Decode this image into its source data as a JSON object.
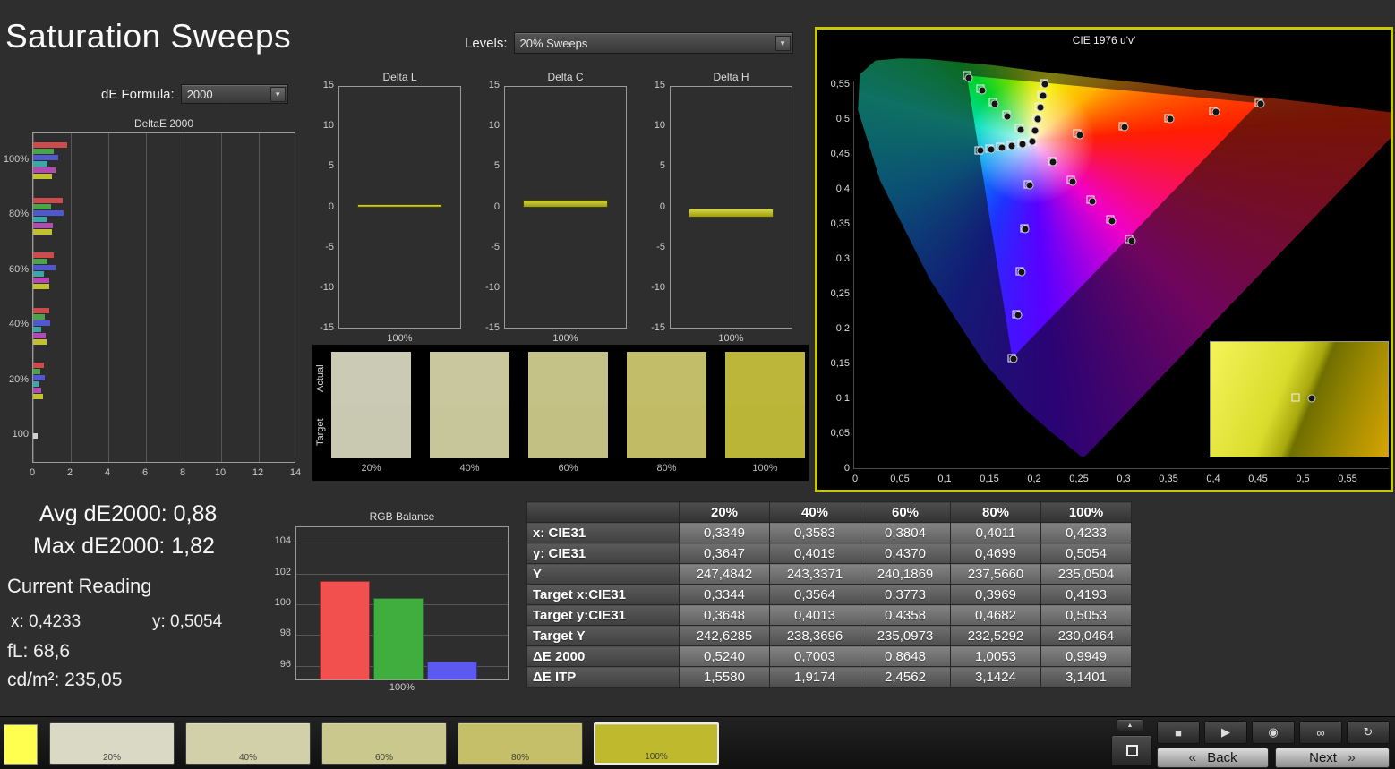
{
  "page": {
    "title": "Saturation Sweeps"
  },
  "controls": {
    "levels_label": "Levels:",
    "levels_value": "20% Sweeps",
    "de_formula_label": "dE Formula:",
    "de_formula_value": "2000"
  },
  "readouts": {
    "avg": "Avg dE2000: 0,88",
    "max": "Max dE2000: 1,82",
    "current_reading_title": "Current Reading",
    "x": "x: 0,4233",
    "y": "y: 0,5054",
    "fl": "fL: 68,6",
    "cdm2": "cd/m²: 235,05"
  },
  "swatch_strip": {
    "actual_label": "Actual",
    "target_label": "Target",
    "items": [
      {
        "label": "20%",
        "actual": "#cbcab5",
        "target": "#c9c8b1"
      },
      {
        "label": "40%",
        "actual": "#c9c79e",
        "target": "#c7c59a"
      },
      {
        "label": "60%",
        "actual": "#c5c287",
        "target": "#c3c083"
      },
      {
        "label": "80%",
        "actual": "#c2bd68",
        "target": "#c0bb64"
      },
      {
        "label": "100%",
        "actual": "#bcb63a",
        "target": "#bab437"
      }
    ]
  },
  "table": {
    "headers": [
      "",
      "20%",
      "40%",
      "60%",
      "80%",
      "100%"
    ],
    "rows": [
      {
        "label": "x: CIE31",
        "values": [
          "0,3349",
          "0,3583",
          "0,3804",
          "0,4011",
          "0,4233"
        ]
      },
      {
        "label": "y: CIE31",
        "values": [
          "0,3647",
          "0,4019",
          "0,4370",
          "0,4699",
          "0,5054"
        ]
      },
      {
        "label": "Y",
        "values": [
          "247,4842",
          "243,3371",
          "240,1869",
          "237,5660",
          "235,0504"
        ]
      },
      {
        "label": "Target x:CIE31",
        "values": [
          "0,3344",
          "0,3564",
          "0,3773",
          "0,3969",
          "0,4193"
        ]
      },
      {
        "label": "Target y:CIE31",
        "values": [
          "0,3648",
          "0,4013",
          "0,4358",
          "0,4682",
          "0,5053"
        ]
      },
      {
        "label": "Target Y",
        "values": [
          "242,6285",
          "238,3696",
          "235,0973",
          "232,5292",
          "230,0464"
        ]
      },
      {
        "label": "ΔE 2000",
        "values": [
          "0,5240",
          "0,7003",
          "0,8648",
          "1,0053",
          "0,9949"
        ]
      },
      {
        "label": "ΔE ITP",
        "values": [
          "1,5580",
          "1,9174",
          "2,4562",
          "3,1424",
          "3,1401"
        ]
      }
    ]
  },
  "bottom_bar": {
    "active_color": "#ffff4f",
    "patches": [
      {
        "label": "20%",
        "color": "#d9d9c6",
        "selected": false
      },
      {
        "label": "40%",
        "color": "#d1d0a9",
        "selected": false
      },
      {
        "label": "60%",
        "color": "#cac88c",
        "selected": false
      },
      {
        "label": "80%",
        "color": "#c4bf68",
        "selected": false
      },
      {
        "label": "100%",
        "color": "#bfb92e",
        "selected": true
      }
    ],
    "transport": [
      {
        "name": "stop",
        "glyph": "■"
      },
      {
        "name": "play",
        "glyph": "▶"
      },
      {
        "name": "record",
        "glyph": "◉"
      },
      {
        "name": "loop",
        "glyph": "∞"
      },
      {
        "name": "refresh",
        "glyph": "↻"
      }
    ],
    "up_glyph": "▲",
    "back_chevron": "«",
    "back_label": "Back",
    "next_label": "Next",
    "next_chevron": "»"
  },
  "chart_data": [
    {
      "id": "deltae2000",
      "type": "bar",
      "orientation": "horizontal",
      "title": "DeltaE 2000",
      "xlim": [
        0,
        14
      ],
      "x_ticks": [
        "0",
        "2",
        "4",
        "6",
        "8",
        "10",
        "12",
        "14"
      ],
      "series_colors": [
        "#cf4a4a",
        "#4aa54a",
        "#5058d0",
        "#3aa8a8",
        "#b34ab3",
        "#c2c22e"
      ],
      "white_color": "#d0d0d0",
      "groups": [
        {
          "label": "100%",
          "values": [
            1.82,
            1.1,
            1.35,
            0.75,
            1.2,
            0.99
          ]
        },
        {
          "label": "80%",
          "values": [
            1.55,
            0.95,
            1.6,
            0.7,
            1.05,
            1.01
          ]
        },
        {
          "label": "60%",
          "values": [
            1.1,
            0.75,
            1.2,
            0.55,
            0.85,
            0.86
          ]
        },
        {
          "label": "40%",
          "values": [
            0.85,
            0.6,
            0.9,
            0.45,
            0.65,
            0.7
          ]
        },
        {
          "label": "20%",
          "values": [
            0.55,
            0.4,
            0.6,
            0.3,
            0.45,
            0.52
          ]
        },
        {
          "label": "100",
          "values": [
            0.25
          ]
        }
      ]
    },
    {
      "id": "delta_l",
      "type": "bar",
      "title": "Delta L",
      "categories": [
        "100%"
      ],
      "values": [
        0.5
      ],
      "ylim": [
        -15,
        15
      ],
      "y_ticks": [
        "15",
        "10",
        "5",
        "0",
        "-5",
        "-10",
        "-15"
      ]
    },
    {
      "id": "delta_c",
      "type": "bar",
      "title": "Delta C",
      "categories": [
        "100%"
      ],
      "values": [
        1.1
      ],
      "ylim": [
        -15,
        15
      ],
      "y_ticks": [
        "15",
        "10",
        "5",
        "0",
        "-5",
        "-10",
        "-15"
      ]
    },
    {
      "id": "delta_h",
      "type": "bar",
      "title": "Delta H",
      "categories": [
        "100%"
      ],
      "values": [
        -1.2
      ],
      "ylim": [
        -15,
        15
      ],
      "y_ticks": [
        "15",
        "10",
        "5",
        "0",
        "-5",
        "-10",
        "-15"
      ]
    },
    {
      "id": "rgb_balance",
      "type": "bar",
      "title": "RGB Balance",
      "categories": [
        "100%"
      ],
      "ylim": [
        95,
        105
      ],
      "y_ticks": [
        "104",
        "102",
        "100",
        "98",
        "96"
      ],
      "series": [
        {
          "name": "red",
          "color": "#f1504e",
          "value": 101.5
        },
        {
          "name": "green",
          "color": "#3fae3f",
          "value": 100.4
        },
        {
          "name": "blue",
          "color": "#5b59f0",
          "value": 96.3
        }
      ]
    },
    {
      "id": "cie1976",
      "type": "scatter",
      "title": "CIE 1976 u'v'",
      "xlim": [
        0,
        0.6
      ],
      "ylim": [
        0,
        0.6
      ],
      "ticks": [
        "0",
        "0,05",
        "0,1",
        "0,15",
        "0,2",
        "0,25",
        "0,3",
        "0,35",
        "0,4",
        "0,45",
        "0,5",
        "0,55"
      ],
      "targets": [
        [
          0.2484,
          0.4792
        ],
        [
          0.299,
          0.4901
        ],
        [
          0.3495,
          0.5011
        ],
        [
          0.4001,
          0.512
        ],
        [
          0.4507,
          0.5229
        ],
        [
          0.1832,
          0.4871
        ],
        [
          0.1687,
          0.506
        ],
        [
          0.1541,
          0.5248
        ],
        [
          0.1396,
          0.5437
        ],
        [
          0.125,
          0.5625
        ],
        [
          0.1933,
          0.4062
        ],
        [
          0.1888,
          0.3441
        ],
        [
          0.1843,
          0.282
        ],
        [
          0.1799,
          0.22
        ],
        [
          0.1754,
          0.1579
        ],
        [
          0.1859,
          0.4657
        ],
        [
          0.174,
          0.4632
        ],
        [
          0.1621,
          0.4606
        ],
        [
          0.1503,
          0.4581
        ],
        [
          0.1384,
          0.4555
        ],
        [
          0.2195,
          0.4403
        ],
        [
          0.2412,
          0.4123
        ],
        [
          0.2629,
          0.3843
        ],
        [
          0.2846,
          0.3563
        ],
        [
          0.3063,
          0.3283
        ],
        [
          0.2003,
          0.4848
        ],
        [
          0.2029,
          0.5013
        ],
        [
          0.2054,
          0.5178
        ],
        [
          0.208,
          0.5344
        ],
        [
          0.2105,
          0.5509
        ],
        [
          0.1978,
          0.4683
        ]
      ],
      "measured": [
        [
          0.2505,
          0.4775
        ],
        [
          0.3012,
          0.4885
        ],
        [
          0.3519,
          0.4995
        ],
        [
          0.4026,
          0.5105
        ],
        [
          0.4533,
          0.5215
        ],
        [
          0.1848,
          0.4852
        ],
        [
          0.1704,
          0.5038
        ],
        [
          0.156,
          0.5224
        ],
        [
          0.1416,
          0.541
        ],
        [
          0.1272,
          0.5596
        ],
        [
          0.1948,
          0.4046
        ],
        [
          0.1904,
          0.3427
        ],
        [
          0.186,
          0.2808
        ],
        [
          0.1816,
          0.2189
        ],
        [
          0.1772,
          0.157
        ],
        [
          0.1872,
          0.4642
        ],
        [
          0.1754,
          0.4618
        ],
        [
          0.1636,
          0.4594
        ],
        [
          0.1518,
          0.457
        ],
        [
          0.14,
          0.4546
        ],
        [
          0.2212,
          0.4385
        ],
        [
          0.2431,
          0.4104
        ],
        [
          0.265,
          0.3823
        ],
        [
          0.2869,
          0.3542
        ],
        [
          0.3088,
          0.3261
        ],
        [
          0.2012,
          0.4834
        ],
        [
          0.204,
          0.5001
        ],
        [
          0.2068,
          0.5168
        ],
        [
          0.2096,
          0.5335
        ],
        [
          0.2124,
          0.5502
        ],
        [
          0.1984,
          0.4678
        ]
      ]
    }
  ]
}
